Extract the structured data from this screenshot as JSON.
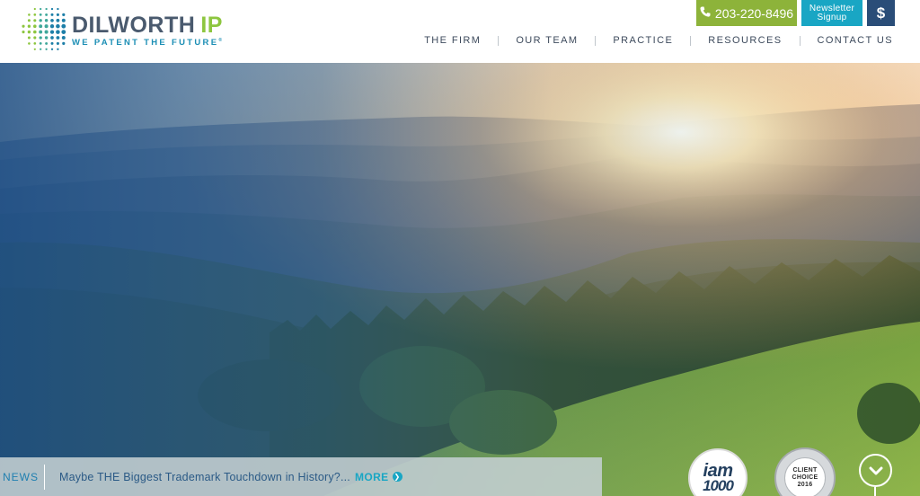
{
  "header": {
    "logo": {
      "name_part1": "DILWORTH",
      "name_part2": "IP",
      "tagline": "WE PATENT THE FUTURE",
      "tagline_mark": "®"
    },
    "phone": {
      "icon": "phone-icon",
      "label": "203-220-8496"
    },
    "newsletter": {
      "label": "Newsletter Signup"
    },
    "payment": {
      "icon": "dollar-icon",
      "label": "$"
    },
    "nav": [
      {
        "label": "THE FIRM"
      },
      {
        "label": "OUR TEAM"
      },
      {
        "label": "PRACTICE"
      },
      {
        "label": "RESOURCES"
      },
      {
        "label": "CONTACT US"
      }
    ]
  },
  "hero": {
    "image": "mountain-sunrise-landscape"
  },
  "ticker": {
    "label": "NEWS",
    "headline": "Maybe THE Biggest Trademark Touchdown in History?...",
    "more_label": "MORE",
    "more_icon": "chevron-right-circle-icon"
  },
  "badges": {
    "iam": {
      "line1": "iam",
      "line2": "1000"
    },
    "client_choice": {
      "line1": "CLIENT",
      "line2": "CHOICE",
      "line3": "2016"
    }
  },
  "scroll_down": {
    "icon": "chevron-down-icon"
  },
  "colors": {
    "phone_button": "#8db33a",
    "newsletter_button": "#19a6c4",
    "payment_button": "#2a4d78",
    "nav_text": "#3d4a5c",
    "logo_green": "#8dc63f",
    "logo_blue": "#1d8fb5"
  }
}
